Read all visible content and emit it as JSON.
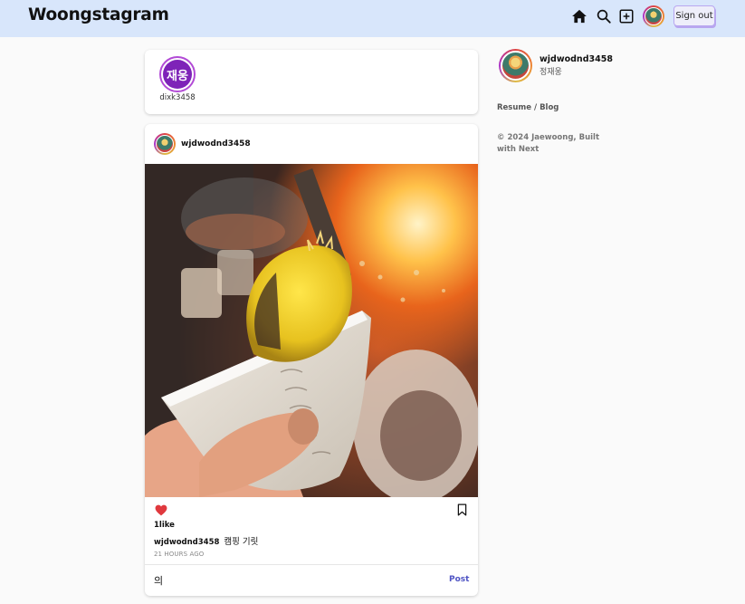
{
  "header": {
    "logo": "Woongstagram",
    "icons": [
      "home-icon",
      "search-icon",
      "plus-square-icon"
    ],
    "signout_label": "Sign out"
  },
  "stories": [
    {
      "avatar_text": "재웅",
      "username": "dixk3458",
      "ring_color": "#b24ad6",
      "fill_color": "#7e23b8"
    }
  ],
  "post": {
    "username": "wjdwodnd3458",
    "likes": "1like",
    "caption_user": "wjdwodnd3458",
    "caption_text": "캠핑 기릿",
    "time": "21 HOURS AGO",
    "comment_value": "의",
    "comment_placeholder": "",
    "post_label": "Post",
    "liked": true,
    "like_color": "#e0393e"
  },
  "sidebar": {
    "username": "wjdwodnd3458",
    "real_name": "정재웅",
    "link_resume": "Resume",
    "link_sep": " / ",
    "link_blog": "Blog",
    "copyright": "© 2024 Jaewoong, Built with Next"
  },
  "colors": {
    "header_bg": "#d8e6fb",
    "accent": "#4f54c4",
    "signout_border": "#b9a8f0"
  }
}
